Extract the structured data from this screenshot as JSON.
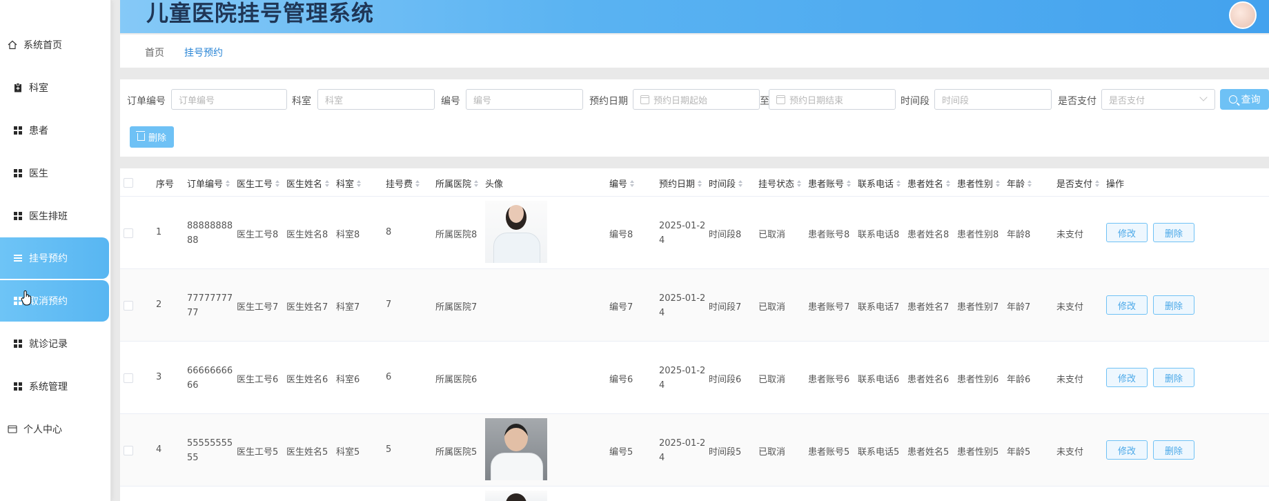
{
  "header": {
    "title": "儿童医院挂号管理系统"
  },
  "sidebar": {
    "items": [
      {
        "label": "系统首页",
        "icon": "home-icon"
      },
      {
        "label": "科室",
        "icon": "clipboard-icon"
      },
      {
        "label": "患者",
        "icon": "grid-icon"
      },
      {
        "label": "医生",
        "icon": "grid-icon"
      },
      {
        "label": "医生排班",
        "icon": "grid-icon"
      },
      {
        "label": "挂号预约",
        "icon": "list-icon"
      },
      {
        "label": "取消预约",
        "icon": "grid-icon"
      },
      {
        "label": "就诊记录",
        "icon": "grid-icon"
      },
      {
        "label": "系统管理",
        "icon": "grid-icon"
      },
      {
        "label": "个人中心",
        "icon": "wallet-icon"
      }
    ]
  },
  "breadcrumb": {
    "home": "首页",
    "current": "挂号预约"
  },
  "search": {
    "order_label": "订单编号",
    "order_placeholder": "订单编号",
    "dept_label": "科室",
    "dept_placeholder": "科室",
    "number_label": "编号",
    "number_placeholder": "编号",
    "date_label": "预约日期",
    "date_start_placeholder": "预约日期起始",
    "date_sep": "至",
    "date_end_placeholder": "预约日期结束",
    "slot_label": "时间段",
    "slot_placeholder": "时间段",
    "paid_label": "是否支付",
    "paid_placeholder": "是否支付",
    "query_button": "查询",
    "delete_button": "删除"
  },
  "table": {
    "columns": [
      "序号",
      "订单编号",
      "医生工号",
      "医生姓名",
      "科室",
      "挂号费",
      "所属医院",
      "头像",
      "编号",
      "预约日期",
      "时间段",
      "挂号状态",
      "患者账号",
      "联系电话",
      "患者姓名",
      "患者性别",
      "年龄",
      "是否支付",
      "操作"
    ],
    "edit_label": "修改",
    "delete_label": "删除",
    "rows": [
      {
        "index": "1",
        "order": "8888888888",
        "doctor_id": "医生工号8",
        "doctor_name": "医生姓名8",
        "dept": "科室8",
        "fee": "8",
        "hospital": "所属医院8",
        "avatar": "female-doctor",
        "number": "编号8",
        "date": "2025-01-24",
        "slot": "时间段8",
        "status": "已取消",
        "patient_account": "患者账号8",
        "phone": "联系电话8",
        "patient_name": "患者姓名8",
        "gender": "患者性别8",
        "age": "年龄8",
        "paid": "未支付"
      },
      {
        "index": "2",
        "order": "7777777777",
        "doctor_id": "医生工号7",
        "doctor_name": "医生姓名7",
        "dept": "科室7",
        "fee": "7",
        "hospital": "所属医院7",
        "avatar": "",
        "number": "编号7",
        "date": "2025-01-24",
        "slot": "时间段7",
        "status": "已取消",
        "patient_account": "患者账号7",
        "phone": "联系电话7",
        "patient_name": "患者姓名7",
        "gender": "患者性别7",
        "age": "年龄7",
        "paid": "未支付"
      },
      {
        "index": "3",
        "order": "6666666666",
        "doctor_id": "医生工号6",
        "doctor_name": "医生姓名6",
        "dept": "科室6",
        "fee": "6",
        "hospital": "所属医院6",
        "avatar": "",
        "number": "编号6",
        "date": "2025-01-24",
        "slot": "时间段6",
        "status": "已取消",
        "patient_account": "患者账号6",
        "phone": "联系电话6",
        "patient_name": "患者姓名6",
        "gender": "患者性别6",
        "age": "年龄6",
        "paid": "未支付"
      },
      {
        "index": "4",
        "order": "5555555555",
        "doctor_id": "医生工号5",
        "doctor_name": "医生姓名5",
        "dept": "科室5",
        "fee": "5",
        "hospital": "所属医院5",
        "avatar": "male-doctor",
        "number": "编号5",
        "date": "2025-01-24",
        "slot": "时间段5",
        "status": "已取消",
        "patient_account": "患者账号5",
        "phone": "联系电话5",
        "patient_name": "患者姓名5",
        "gender": "患者性别5",
        "age": "年龄5",
        "paid": "未支付"
      }
    ]
  },
  "colors": {
    "accent": "#6ec1f5",
    "header_start": "#85c9f7",
    "header_end": "#43a2ee",
    "link": "#2b86d6"
  }
}
